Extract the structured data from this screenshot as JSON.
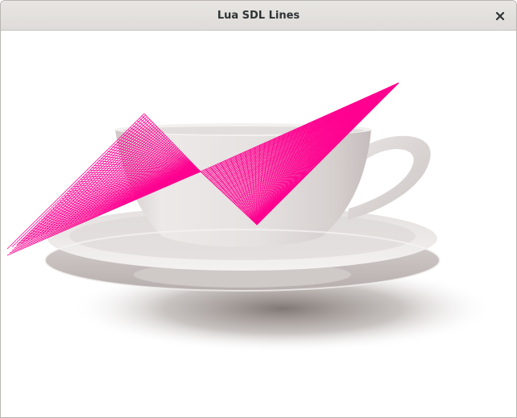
{
  "window": {
    "title": "Lua SDL Lines",
    "close_icon": "close-icon"
  },
  "canvas": {
    "background_image": "teacup-on-saucer",
    "line_color": "#ff0090"
  }
}
